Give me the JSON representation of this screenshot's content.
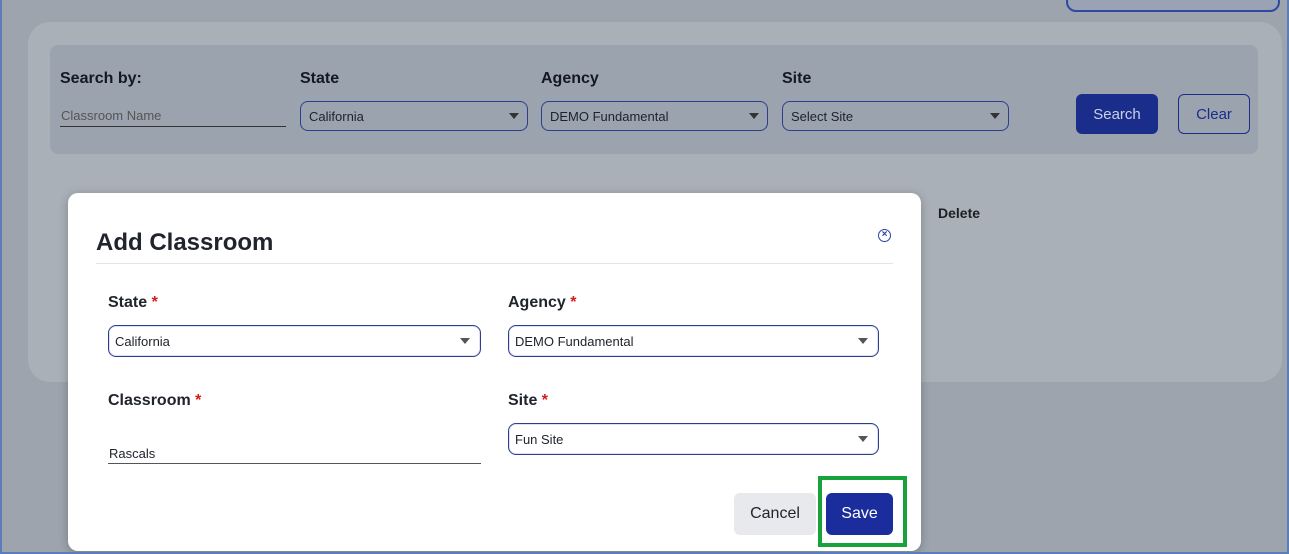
{
  "background": {
    "filters": {
      "search_by_label": "Search by:",
      "classroom_name_placeholder": "Classroom Name",
      "state_label": "State",
      "state_value": "California",
      "agency_label": "Agency",
      "agency_value": "DEMO Fundamental",
      "site_label": "Site",
      "site_value": "Select Site"
    },
    "buttons": {
      "search": "Search",
      "clear": "Clear"
    },
    "table": {
      "delete_header": "Delete"
    }
  },
  "modal": {
    "title": "Add Classroom",
    "required_marker": "*",
    "state": {
      "label": "State",
      "value": "California"
    },
    "agency": {
      "label": "Agency",
      "value": "DEMO Fundamental"
    },
    "classroom": {
      "label": "Classroom",
      "value": "Rascals"
    },
    "site": {
      "label": "Site",
      "value": "Fun Site"
    },
    "cancel_label": "Cancel",
    "save_label": "Save",
    "close_icon": "close-circle-icon"
  },
  "colors": {
    "primary": "#1b2d9c",
    "required": "#d61a1a",
    "highlight": "#18a33a",
    "overlay": "#9ea4ad"
  }
}
